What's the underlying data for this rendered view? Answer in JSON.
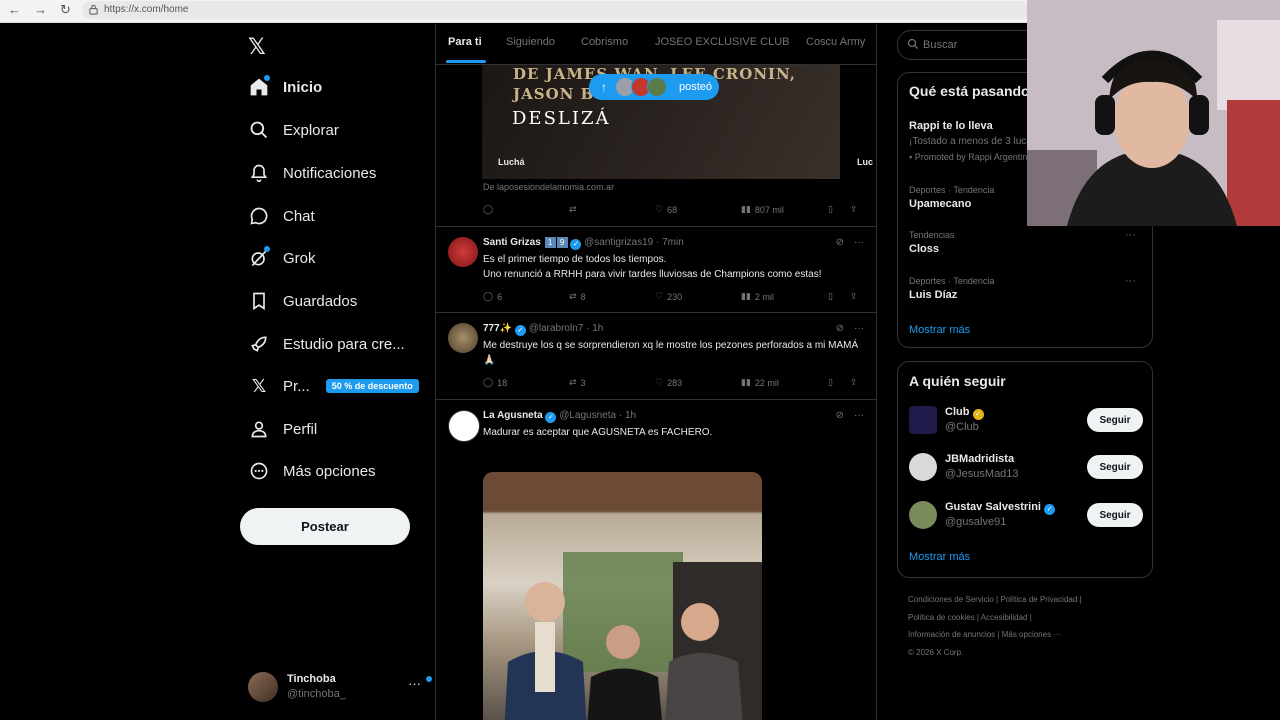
{
  "browser": {
    "url": "https://x.com/home"
  },
  "nav": {
    "items": [
      {
        "label": "Inicio"
      },
      {
        "label": "Explorar"
      },
      {
        "label": "Notificaciones"
      },
      {
        "label": "Chat"
      },
      {
        "label": "Grok"
      },
      {
        "label": "Guardados"
      },
      {
        "label": "Estudio para cre..."
      },
      {
        "label": "Pr...",
        "badge": "50 % de descuento"
      },
      {
        "label": "Perfil"
      },
      {
        "label": "Más opciones"
      }
    ],
    "post_button": "Postear"
  },
  "account": {
    "name": "Tinchoba",
    "handle": "@tinchoba_"
  },
  "tabs": [
    "Para ti",
    "Siguiendo",
    "Cobrismo",
    "JOSEO EXCLUSIVE CLUB",
    "Coscu Army"
  ],
  "feed": {
    "posted_pill": "posteó",
    "media": {
      "line1": "DE JAMES WAN, LEE CRONIN,",
      "line2": "JASON B",
      "line2_tail": "NE",
      "cta": "DESLIZÁ",
      "left_label": "Luchá",
      "right_label": "Luc",
      "source": "De laposesiondelamomia.com.ar",
      "likes": "68",
      "views": "807 mil"
    },
    "tweets": [
      {
        "name": "Santi Grizas",
        "badges": [
          "1",
          "9"
        ],
        "handle": "@santigrizas19",
        "time": "· 7min",
        "lines": [
          "Es el primer tiempo de todos los tiempos.",
          "Uno renunció a RRHH para vivir tardes lluviosas de Champions como estas!"
        ],
        "replies": "6",
        "reposts": "8",
        "likes": "230",
        "views": "2 mil"
      },
      {
        "name": "777✨",
        "handle": "@larabroln7",
        "time": "· 1h",
        "lines": [
          "Me destruye los q se sorprendieron xq le mostre los pezones perforados a mi MAMÁ🙏🏻"
        ],
        "replies": "18",
        "reposts": "3",
        "likes": "283",
        "views": "22 mil"
      },
      {
        "name": "La Agusneta",
        "handle": "@Lagusneta",
        "time": "· 1h",
        "lines": [
          "Madurar es aceptar que AGUSNETA es FACHERO."
        ]
      }
    ]
  },
  "right": {
    "search_placeholder": "Buscar",
    "trends_title": "Qué está pasando",
    "promo": {
      "name": "Rappi te lo lleva",
      "desc": "¡Tostado a menos de 3 lucas!",
      "promoted": "Promoted by Rappi Argentina"
    },
    "trends": [
      {
        "category": "Deportes · Tendencia",
        "name": "Upamecano"
      },
      {
        "category": "Tendencias",
        "name": "Closs"
      },
      {
        "category": "Deportes · Tendencia",
        "name": "Luis Díaz"
      }
    ],
    "show_more": "Mostrar más",
    "follow_title": "A quién seguir",
    "follow": [
      {
        "name": "Club",
        "handle": "@Club"
      },
      {
        "name": "JBMadridista",
        "handle": "@JesusMad13"
      },
      {
        "name": "Gustav Salvestrini",
        "handle": "@gusalve91"
      }
    ],
    "follow_button": "Seguir",
    "footer": [
      "Condiciones de Servicio",
      "Política de Privacidad",
      "Política de cookies",
      "Accesibilidad",
      "Información de anuncios",
      "Más opciones ···",
      "© 2026 X Corp."
    ]
  },
  "colors": {
    "accent": "#1d9bf0",
    "background": "#000000",
    "text": "#e7e9ea",
    "muted": "#71767b",
    "border": "#2f3336"
  },
  "icons": [
    "x-logo-icon",
    "home-icon",
    "search-icon",
    "bell-icon",
    "chat-icon",
    "grok-icon",
    "bookmark-icon",
    "rocket-icon",
    "premium-x-icon",
    "person-icon",
    "more-circle-icon"
  ]
}
